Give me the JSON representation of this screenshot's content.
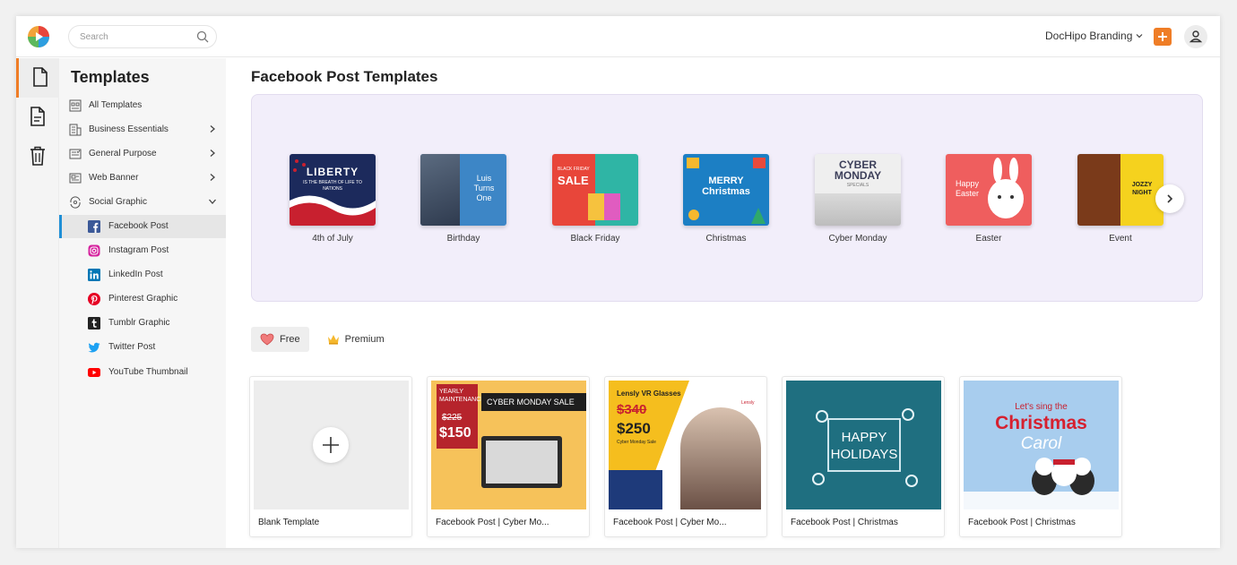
{
  "header": {
    "search_placeholder": "Search",
    "brand_menu_label": "DocHipo Branding",
    "accent_color": "#ef7d26"
  },
  "rail": {
    "items": [
      "document-icon",
      "file-text-icon",
      "trash-icon"
    ]
  },
  "sidebar": {
    "title": "Templates",
    "items": [
      {
        "label": "All Templates",
        "icon": "grid-icon"
      },
      {
        "label": "Business Essentials",
        "icon": "building-icon"
      },
      {
        "label": "General Purpose",
        "icon": "card-icon"
      },
      {
        "label": "Web Banner",
        "icon": "banner-icon"
      },
      {
        "label": "Social Graphic",
        "icon": "social-icon"
      }
    ],
    "sub_items": [
      {
        "label": "Facebook Post",
        "icon": "facebook-icon",
        "color": "#3b5998"
      },
      {
        "label": "Instagram Post",
        "icon": "instagram-icon",
        "color": "#d6249f"
      },
      {
        "label": "LinkedIn Post",
        "icon": "linkedin-icon",
        "color": "#0077b5"
      },
      {
        "label": "Pinterest Graphic",
        "icon": "pinterest-icon",
        "color": "#e60023"
      },
      {
        "label": "Tumblr Graphic",
        "icon": "tumblr-icon",
        "color": "#222222"
      },
      {
        "label": "Twitter Post",
        "icon": "twitter-icon",
        "color": "#1da1f2"
      },
      {
        "label": "YouTube Thumbnail",
        "icon": "youtube-icon",
        "color": "#ff0000"
      }
    ]
  },
  "main": {
    "title": "Facebook Post Templates",
    "categories": [
      {
        "label": "4th of July",
        "thumb_text": "LIBERTY",
        "thumb_sub": "IS THE BREATH OF LIFE TO NATIONS"
      },
      {
        "label": "Birthday",
        "thumb_text": "Luis Turns One",
        "thumb_sub": ""
      },
      {
        "label": "Black Friday",
        "thumb_text": "SALE",
        "thumb_sub": "BLACK FRIDAY"
      },
      {
        "label": "Christmas",
        "thumb_text": "MERRY Christmas",
        "thumb_sub": ""
      },
      {
        "label": "Cyber Monday",
        "thumb_text": "CYBER MONDAY",
        "thumb_sub": "SPECIALS"
      },
      {
        "label": "Easter",
        "thumb_text": "Happy Easter",
        "thumb_sub": ""
      },
      {
        "label": "Event",
        "thumb_text": "JOZZY NIGHT",
        "thumb_sub": ""
      }
    ],
    "filters": [
      {
        "label": "Free",
        "icon": "heart-icon"
      },
      {
        "label": "Premium",
        "icon": "crown-icon"
      }
    ],
    "cards": [
      {
        "caption": "Blank Template"
      },
      {
        "caption": "Facebook Post | Cyber Mo...",
        "img": {
          "tag": "YEARLY MAINTENANCE",
          "old": "$225",
          "new": "$150",
          "headline": "CYBER MONDAY SALE"
        }
      },
      {
        "caption": "Facebook Post | Cyber Mo...",
        "img": {
          "tag": "Lensly VR Glasses",
          "old": "$340",
          "new": "$250",
          "sub": "Cyber Monday Sale",
          "brand": "Lensly"
        }
      },
      {
        "caption": "Facebook Post | Christmas",
        "img": {
          "line1": "HAPPY",
          "line2": "HOLIDAYS"
        }
      },
      {
        "caption": "Facebook Post | Christmas",
        "img": {
          "line1": "Let's sing the",
          "line2": "Christmas",
          "line3": "Carol"
        }
      }
    ]
  }
}
